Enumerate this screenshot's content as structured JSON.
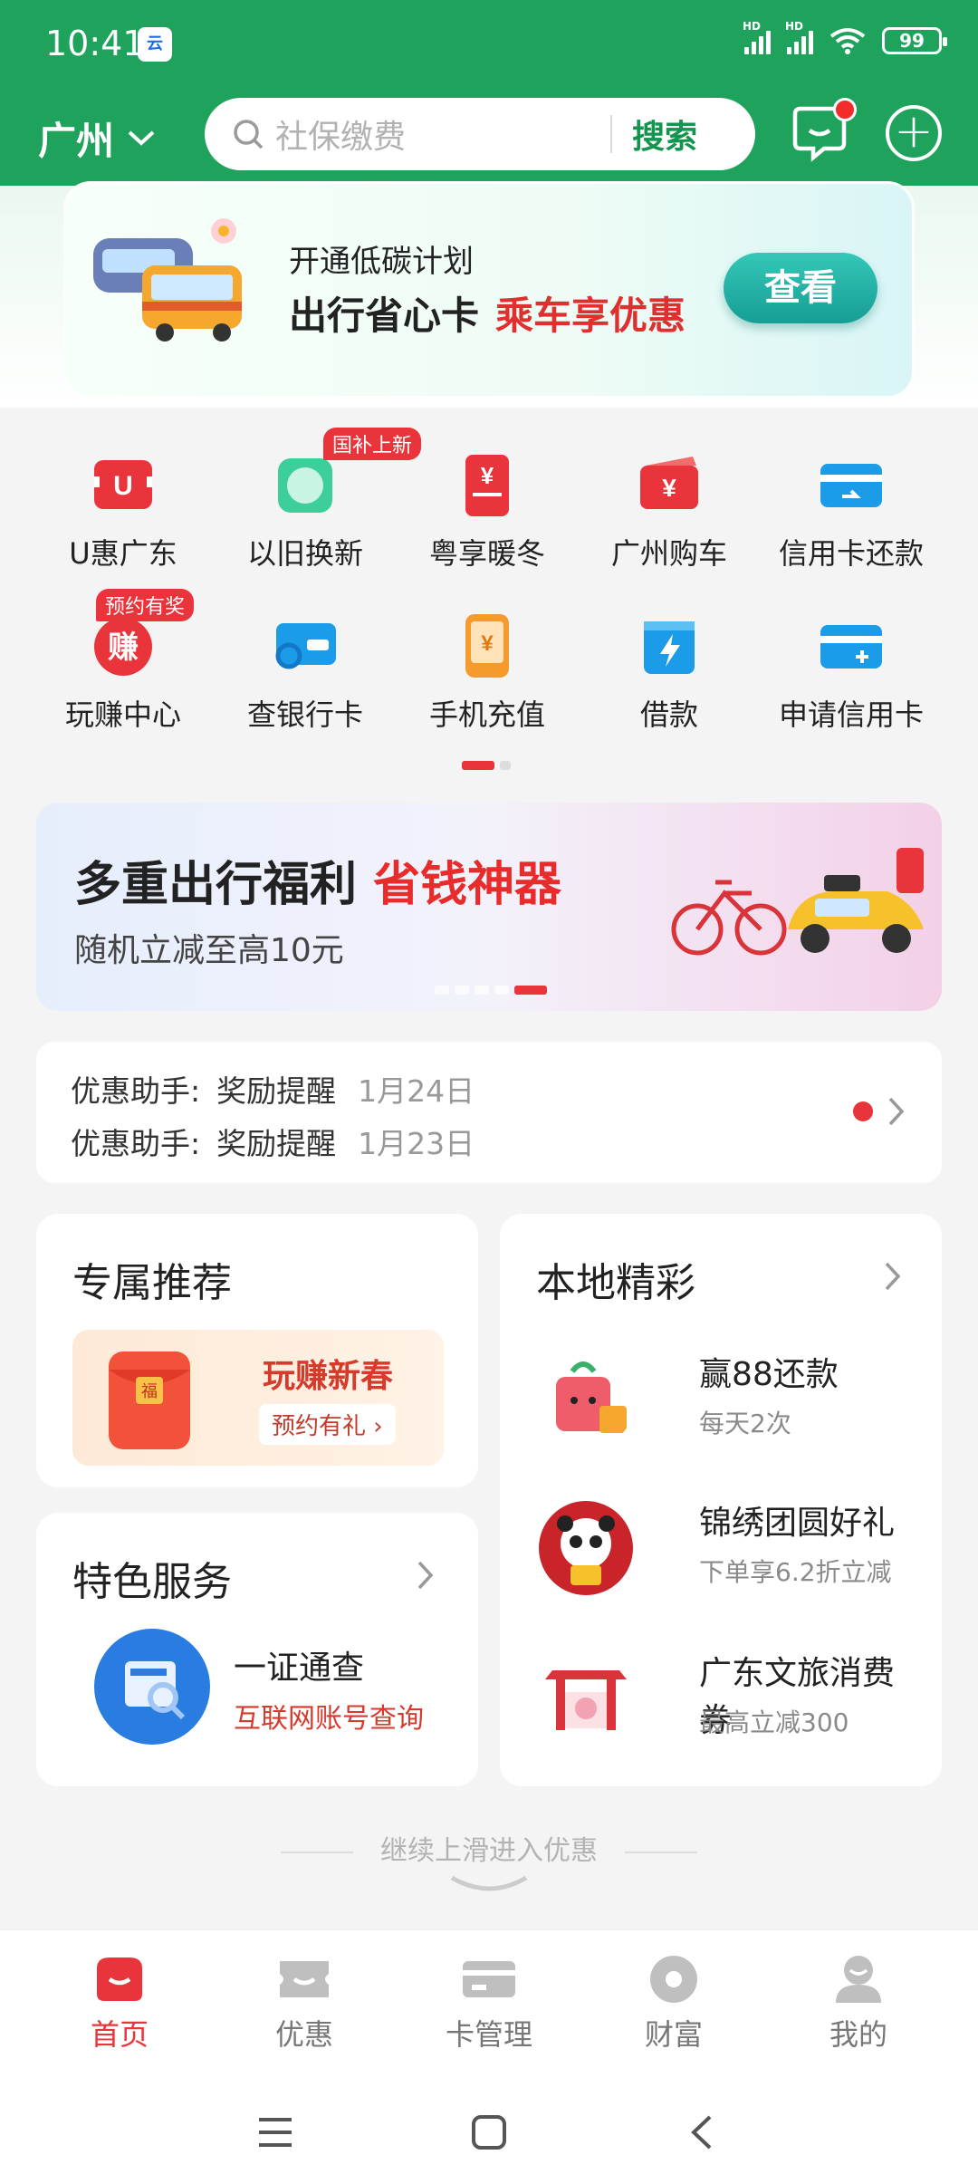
{
  "status": {
    "time": "10:41",
    "app_badge": "云",
    "battery": "99",
    "hd1": "HD",
    "hd2": "HD"
  },
  "header": {
    "city": "广州",
    "search_placeholder": "社保缴费",
    "search_button": "搜索"
  },
  "carbon_banner": {
    "line1": "开通低碳计划",
    "line2_black": "出行省心卡",
    "line2_red": "乘车享优惠",
    "button": "查看"
  },
  "grid": {
    "items": [
      {
        "label": "U惠广东",
        "icon": "u-hui-icon",
        "tag": ""
      },
      {
        "label": "以旧换新",
        "icon": "trade-in-icon",
        "tag": "国补上新"
      },
      {
        "label": "粤享暖冬",
        "icon": "winter-coupon-icon",
        "tag": ""
      },
      {
        "label": "广州购车",
        "icon": "car-purchase-icon",
        "tag": ""
      },
      {
        "label": "信用卡还款",
        "icon": "credit-card-repay-icon",
        "tag": ""
      },
      {
        "label": "玩赚中心",
        "icon": "earn-center-icon",
        "tag": "预约有奖"
      },
      {
        "label": "查银行卡",
        "icon": "bank-card-query-icon",
        "tag": ""
      },
      {
        "label": "手机充值",
        "icon": "phone-recharge-icon",
        "tag": ""
      },
      {
        "label": "借款",
        "icon": "loan-icon",
        "tag": ""
      },
      {
        "label": "申请信用卡",
        "icon": "apply-credit-card-icon",
        "tag": ""
      }
    ]
  },
  "travel_banner": {
    "title_black": "多重出行福利",
    "title_red": "省钱神器",
    "subtitle": "随机立减至高10元"
  },
  "notices": [
    {
      "label": "优惠助手:",
      "text": "奖励提醒",
      "date": "1月24日"
    },
    {
      "label": "优惠助手:",
      "text": "奖励提醒",
      "date": "1月23日"
    }
  ],
  "exclusive": {
    "title": "专属推荐",
    "promo_title": "玩赚新春",
    "promo_button": "预约有礼 ›"
  },
  "featured": {
    "title": "特色服务",
    "item_title": "一证通查",
    "item_sub": "互联网账号查询"
  },
  "local": {
    "title": "本地精彩",
    "items": [
      {
        "title": "赢88还款",
        "sub": "每天2次"
      },
      {
        "title": "锦绣团圆好礼",
        "sub": "下单享6.2折立减"
      },
      {
        "title": "广东文旅消费券",
        "sub": "最高立减300"
      }
    ]
  },
  "more_hint": "继续上滑进入优惠",
  "tabs": [
    {
      "label": "首页",
      "active": true
    },
    {
      "label": "优惠",
      "active": false
    },
    {
      "label": "卡管理",
      "active": false
    },
    {
      "label": "财富",
      "active": false
    },
    {
      "label": "我的",
      "active": false
    }
  ],
  "colors": {
    "brand_green": "#1fa35c",
    "accent_red": "#e8343a",
    "search_green": "#12954f"
  }
}
